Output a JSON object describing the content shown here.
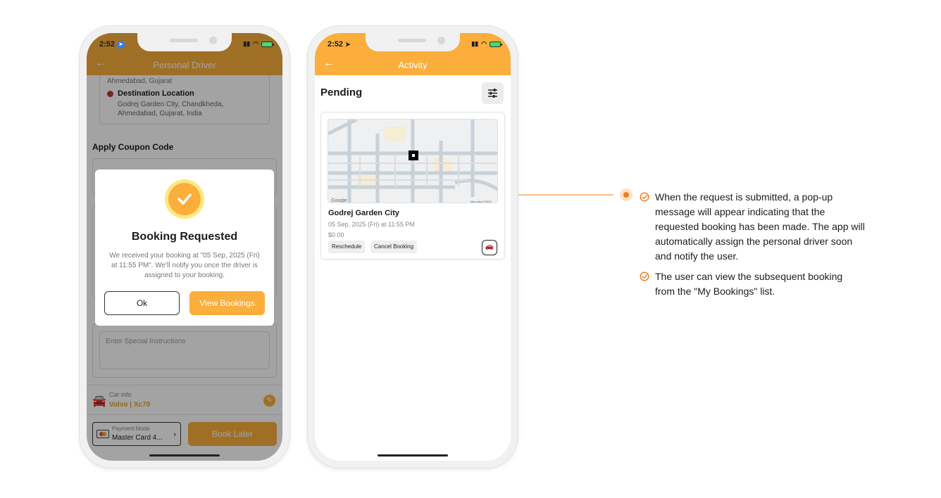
{
  "phone1": {
    "status": {
      "time": "2:52"
    },
    "appbar": {
      "title": "Personal Driver"
    },
    "pickup_partial": "Ahmedabad, Gujarat",
    "destination": {
      "label": "Destination Location",
      "address": "Godrej Garden City, Chandkheda, Ahmedabad, Gujarat, India"
    },
    "coupon_title": "Apply Coupon Code",
    "special_instructions_placeholder": "Enter Special Instructions",
    "car_info": {
      "label": "Car info",
      "value": "Volvo | Xc70"
    },
    "payment": {
      "label": "Payment Mode",
      "value": "Master Card 4..."
    },
    "book_later_label": "Book Later",
    "dialog": {
      "title": "Booking Requested",
      "message": "We received your booking at \"05 Sep, 2025 (Fri) at 11:55 PM\". We'll notify you once the driver is assigned to your booking.",
      "ok_label": "Ok",
      "view_label": "View Bookings"
    }
  },
  "phone2": {
    "status": {
      "time": "2:52"
    },
    "appbar": {
      "title": "Activity"
    },
    "section_title": "Pending",
    "booking": {
      "name": "Godrej Garden City",
      "date": "05 Sep, 2025 (Fri) at 11:55 PM",
      "price": "$0.00",
      "reschedule_label": "Reschedule",
      "cancel_label": "Cancel Booking",
      "map_logo": "Google",
      "map_credit": "Map data ©2025"
    }
  },
  "annotation": {
    "accent_color": "#f07c1f",
    "notes": [
      "When the request is submitted, a pop-up message will appear indicating that the requested booking has been made. The app will automatically assign the personal driver soon and notify the user.",
      "The user can view the subsequent booking from the \"My Bookings\" list."
    ]
  },
  "colors": {
    "brand": "#fbae3c",
    "destination_dot": "#c0392b"
  }
}
